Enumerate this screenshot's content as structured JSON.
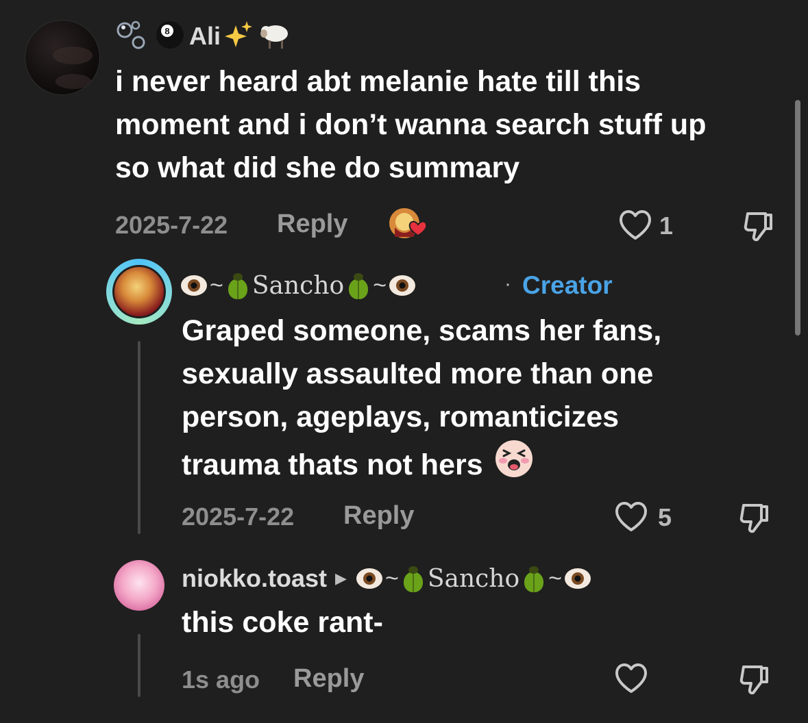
{
  "comments": [
    {
      "username": "Ali",
      "text_lines": [
        "i never heard abt melanie hate till this",
        "moment and i don’t wanna search stuff up",
        "so what did she do summary"
      ],
      "date": "2025-7-22",
      "reply_label": "Reply",
      "likes": "1"
    },
    {
      "username": "Sancho",
      "badge_sep": "·",
      "badge": "Creator",
      "text_lines": [
        "Graped someone, scams her fans,",
        "sexually assaulted more than one",
        "person, ageplays, romanticizes",
        "trauma thats not hers"
      ],
      "date": "2025-7-22",
      "reply_label": "Reply",
      "likes": "5"
    },
    {
      "username": "niokko.toast",
      "reply_to": "Sancho",
      "text_lines": [
        "this coke rant-"
      ],
      "date": "1s ago",
      "reply_label": "Reply"
    }
  ],
  "icons": {
    "like": "heart-outline-icon",
    "dislike": "thumbs-down-icon",
    "creator_liked": "creator-liked-heart-icon"
  },
  "colors": {
    "background": "#1f1f1f",
    "creator_badge": "#4aa3e6",
    "text": "#ffffff",
    "muted": "#8e8e8e"
  }
}
